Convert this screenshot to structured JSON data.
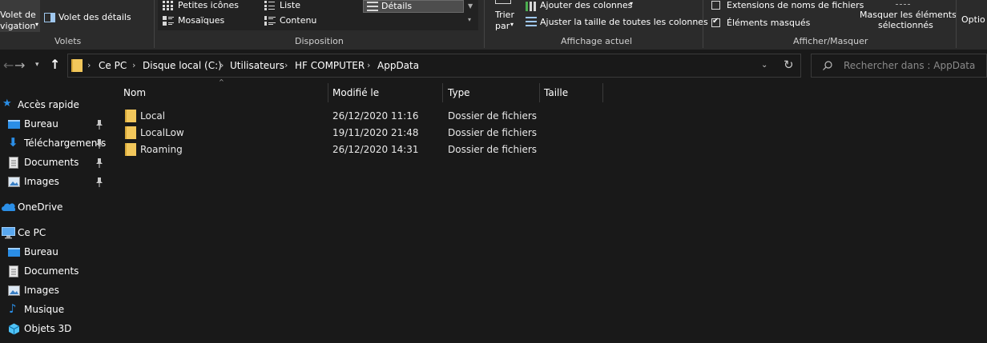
{
  "ribbon": {
    "panes": {
      "nav_pane_line1": "Volet de",
      "nav_pane_line2": "vigation",
      "details_pane": "Volet des détails",
      "group": "Volets"
    },
    "layout": {
      "small_icons": "Petites icônes",
      "list": "Liste",
      "details": "Détails",
      "tiles": "Mosaïques",
      "content": "Contenu",
      "group": "Disposition"
    },
    "current_view": {
      "sort_line1": "Trier",
      "sort_line2": "par",
      "add_columns": "Ajouter des colonnes",
      "fit_columns": "Ajuster la taille de toutes les colonnes",
      "group": "Affichage actuel"
    },
    "show_hide": {
      "extensions": "Extensions de noms de fichiers",
      "extensions_checked": false,
      "hidden_items": "Éléments masqués",
      "hidden_items_checked": true,
      "hide_selected_line1": "Masquer les éléments",
      "hide_selected_line2": "sélectionnés",
      "group": "Afficher/Masquer"
    },
    "options": "Optio"
  },
  "address": {
    "crumbs": [
      "Ce PC",
      "Disque local (C:)",
      "Utilisateurs",
      "HF COMPUTER",
      "AppData"
    ],
    "search_placeholder": "Rechercher dans : AppData"
  },
  "nav": {
    "quick_access": "Accès rapide",
    "desktop": "Bureau",
    "downloads": "Téléchargements",
    "documents": "Documents",
    "images": "Images",
    "onedrive": "OneDrive",
    "this_pc": "Ce PC",
    "pc_desktop": "Bureau",
    "pc_documents": "Documents",
    "pc_images": "Images",
    "pc_music": "Musique",
    "pc_3d": "Objets 3D"
  },
  "columns": {
    "name": "Nom",
    "modified": "Modifié le",
    "type": "Type",
    "size": "Taille"
  },
  "files": [
    {
      "name": "Local",
      "modified": "26/12/2020 11:16",
      "type": "Dossier de fichiers"
    },
    {
      "name": "LocalLow",
      "modified": "19/11/2020 21:48",
      "type": "Dossier de fichiers"
    },
    {
      "name": "Roaming",
      "modified": "26/12/2020 14:31",
      "type": "Dossier de fichiers"
    }
  ],
  "colors": {
    "background": "#191919",
    "ribbon": "#2b2b2b",
    "folder": "#f2c75b",
    "accent_blue": "#2b8ee6"
  }
}
